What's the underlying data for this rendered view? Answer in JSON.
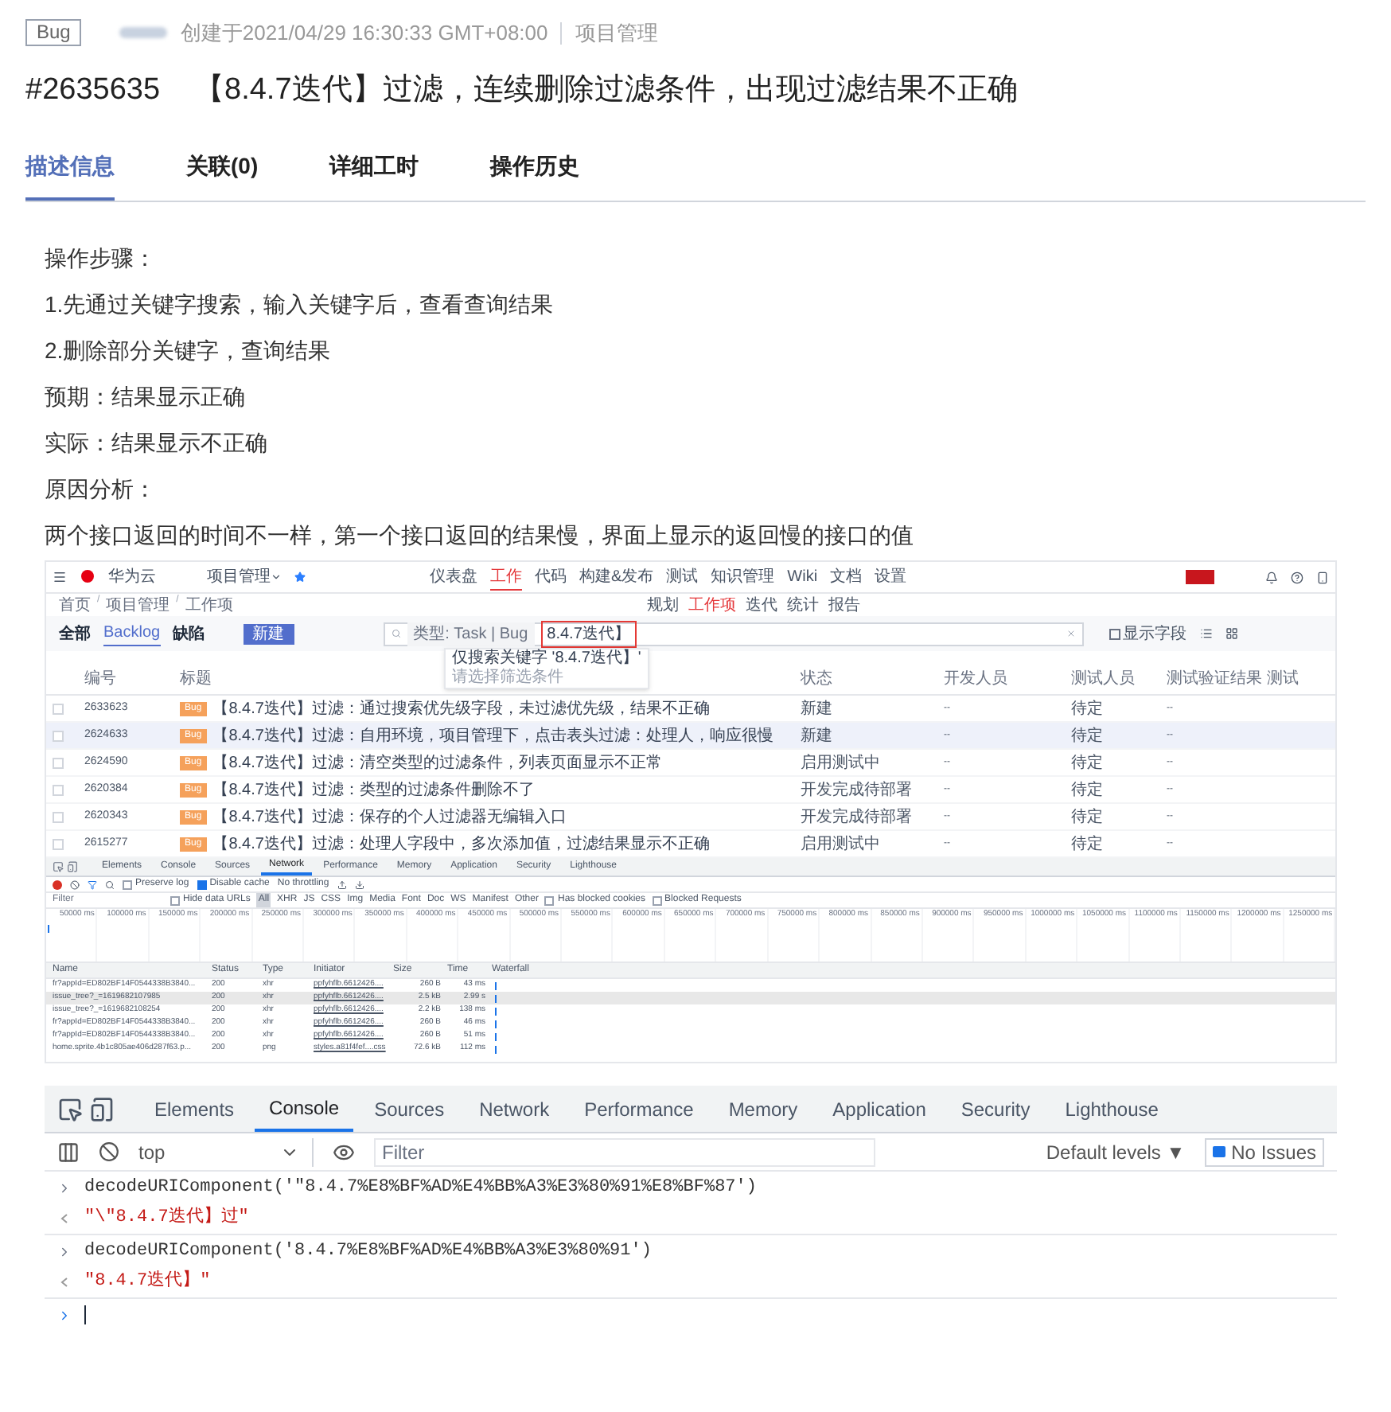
{
  "header": {
    "badge": "Bug",
    "created": "创建于2021/04/29 16:30:33 GMT+08:00",
    "project": "项目管理",
    "id": "#2635635",
    "title": "【8.4.7迭代】过滤，连续删除过滤条件，出现过滤结果不正确"
  },
  "tabs": [
    {
      "label": "描述信息",
      "selected": true
    },
    {
      "label": "关联(0)",
      "selected": false
    },
    {
      "label": "详细工时",
      "selected": false
    },
    {
      "label": "操作历史",
      "selected": false
    }
  ],
  "description": [
    "操作步骤：",
    "1.先通过关键字搜索，输入关键字后，查看查询结果",
    "2.删除部分关键字，查询结果",
    "预期：结果显示正确",
    "实际：结果显示不正确",
    "原因分析：",
    "两个接口返回的时间不一样，第一个接口返回的结果慢，界面上显示的返回慢的接口的值"
  ],
  "embedded_app": {
    "brand": "华为云",
    "project_menu": "项目管理",
    "nav": [
      {
        "label": "仪表盘",
        "selected": false
      },
      {
        "label": "工作",
        "selected": true
      },
      {
        "label": "代码",
        "selected": false
      },
      {
        "label": "构建&发布",
        "selected": false
      },
      {
        "label": "测试",
        "selected": false
      },
      {
        "label": "知识管理",
        "selected": false
      },
      {
        "label": "Wiki",
        "selected": false
      },
      {
        "label": "文档",
        "selected": false
      },
      {
        "label": "设置",
        "selected": false
      }
    ],
    "breadcrumb": [
      "首页",
      "项目管理",
      "工作项"
    ],
    "breadcrumb_separator": "/",
    "subnav": [
      {
        "label": "规划",
        "selected": false
      },
      {
        "label": "工作项",
        "selected": true
      },
      {
        "label": "迭代",
        "selected": false
      },
      {
        "label": "统计",
        "selected": false
      },
      {
        "label": "报告",
        "selected": false
      }
    ],
    "views": [
      {
        "label": "全部",
        "selected": false
      },
      {
        "label": "Backlog",
        "selected": true
      },
      {
        "label": "缺陷",
        "selected": false
      }
    ],
    "new_button": "新建",
    "filter_chip": "类型: Task | Bug",
    "search_value": "8.4.7迭代】",
    "suggestion": "仅搜索关键字 '8.4.7迭代】'",
    "suggestion_hint": "请选择筛选条件",
    "show_fields": "显示字段",
    "columns": [
      "编号",
      "标题",
      "状态",
      "开发人员",
      "测试人员",
      "测试验证结果 测试"
    ],
    "rows": [
      {
        "id": "2633623",
        "type": "Bug",
        "title": "【8.4.7迭代】过滤：通过搜索优先级字段，未过滤优先级，结果不正确",
        "status": "新建",
        "dev": "--",
        "tester": "待定",
        "result": "--",
        "selected": false
      },
      {
        "id": "2624633",
        "type": "Bug",
        "title": "【8.4.7迭代】过滤：自用环境，项目管理下，点击表头过滤：处理人，响应很慢",
        "status": "新建",
        "dev": "--",
        "tester": "待定",
        "result": "--",
        "selected": true
      },
      {
        "id": "2624590",
        "type": "Bug",
        "title": "【8.4.7迭代】过滤：清空类型的过滤条件，列表页面显示不正常",
        "status": "启用测试中",
        "dev": "--",
        "tester": "待定",
        "result": "--",
        "selected": false
      },
      {
        "id": "2620384",
        "type": "Bug",
        "title": "【8.4.7迭代】过滤：类型的过滤条件删除不了",
        "status": "开发完成待部署",
        "dev": "--",
        "tester": "待定",
        "result": "--",
        "selected": false
      },
      {
        "id": "2620343",
        "type": "Bug",
        "title": "【8.4.7迭代】过滤：保存的个人过滤器无编辑入口",
        "status": "开发完成待部署",
        "dev": "--",
        "tester": "待定",
        "result": "--",
        "selected": false
      },
      {
        "id": "2615277",
        "type": "Bug",
        "title": "【8.4.7迭代】过滤：处理人字段中，多次添加值，过滤结果显示不正确",
        "status": "启用测试中",
        "dev": "--",
        "tester": "待定",
        "result": "--",
        "selected": false
      }
    ]
  },
  "network_devtools": {
    "tabs": [
      {
        "label": "Elements",
        "selected": false
      },
      {
        "label": "Console",
        "selected": false
      },
      {
        "label": "Sources",
        "selected": false
      },
      {
        "label": "Network",
        "selected": true
      },
      {
        "label": "Performance",
        "selected": false
      },
      {
        "label": "Memory",
        "selected": false
      },
      {
        "label": "Application",
        "selected": false
      },
      {
        "label": "Security",
        "selected": false
      },
      {
        "label": "Lighthouse",
        "selected": false
      }
    ],
    "preserve_log": {
      "label": "Preserve log",
      "checked": false
    },
    "disable_cache": {
      "label": "Disable cache",
      "checked": true
    },
    "throttling": "No throttling",
    "filter_placeholder": "Filter",
    "hide_data_urls": {
      "label": "Hide data URLs",
      "checked": false
    },
    "types": [
      {
        "label": "All",
        "selected": true
      },
      {
        "label": "XHR",
        "selected": false
      },
      {
        "label": "JS",
        "selected": false
      },
      {
        "label": "CSS",
        "selected": false
      },
      {
        "label": "Img",
        "selected": false
      },
      {
        "label": "Media",
        "selected": false
      },
      {
        "label": "Font",
        "selected": false
      },
      {
        "label": "Doc",
        "selected": false
      },
      {
        "label": "WS",
        "selected": false
      },
      {
        "label": "Manifest",
        "selected": false
      },
      {
        "label": "Other",
        "selected": false
      }
    ],
    "blocked_cookies": {
      "label": "Has blocked cookies",
      "checked": false
    },
    "blocked_requests": {
      "label": "Blocked Requests",
      "checked": false
    },
    "ticks": [
      "50000 ms",
      "100000 ms",
      "150000 ms",
      "200000 ms",
      "250000 ms",
      "300000 ms",
      "350000 ms",
      "400000 ms",
      "450000 ms",
      "500000 ms",
      "550000 ms",
      "600000 ms",
      "650000 ms",
      "700000 ms",
      "750000 ms",
      "800000 ms",
      "850000 ms",
      "900000 ms",
      "950000 ms",
      "1000000 ms",
      "1050000 ms",
      "1100000 ms",
      "1150000 ms",
      "1200000 ms",
      "1250000 ms"
    ],
    "columns": [
      "Name",
      "Status",
      "Type",
      "Initiator",
      "Size",
      "Time",
      "Waterfall"
    ],
    "requests": [
      {
        "name": "fr?appId=ED802BF14F0544338B3840...",
        "status": "200",
        "type": "xhr",
        "initiator": "ppfyhflb.6612426....",
        "size": "260 B",
        "time": "43 ms",
        "selected": false
      },
      {
        "name": "issue_tree?_=1619682107985",
        "status": "200",
        "type": "xhr",
        "initiator": "ppfyhflb.6612426....",
        "size": "2.5 kB",
        "time": "2.99 s",
        "selected": true
      },
      {
        "name": "issue_tree?_=1619682108254",
        "status": "200",
        "type": "xhr",
        "initiator": "ppfyhflb.6612426....",
        "size": "2.2 kB",
        "time": "138 ms",
        "selected": false
      },
      {
        "name": "fr?appId=ED802BF14F0544338B3840...",
        "status": "200",
        "type": "xhr",
        "initiator": "ppfyhflb.6612426....",
        "size": "260 B",
        "time": "46 ms",
        "selected": false
      },
      {
        "name": "fr?appId=ED802BF14F0544338B3840...",
        "status": "200",
        "type": "xhr",
        "initiator": "ppfyhflb.6612426....",
        "size": "260 B",
        "time": "51 ms",
        "selected": false
      },
      {
        "name": "home.sprite.4b1c805ae406d287f63.p...",
        "status": "200",
        "type": "png",
        "initiator": "styles.a81f4fef....css",
        "size": "72.6 kB",
        "time": "112 ms",
        "selected": false
      }
    ]
  },
  "console": {
    "tabs": [
      {
        "label": "Elements",
        "selected": false
      },
      {
        "label": "Console",
        "selected": true
      },
      {
        "label": "Sources",
        "selected": false
      },
      {
        "label": "Network",
        "selected": false
      },
      {
        "label": "Performance",
        "selected": false
      },
      {
        "label": "Memory",
        "selected": false
      },
      {
        "label": "Application",
        "selected": false
      },
      {
        "label": "Security",
        "selected": false
      },
      {
        "label": "Lighthouse",
        "selected": false
      }
    ],
    "context": "top",
    "filter_placeholder": "Filter",
    "levels": "Default levels ▼",
    "issues": "No Issues",
    "lines": [
      {
        "kind": "input",
        "text": "decodeURIComponent('\"8.4.7%E8%BF%AD%E4%BB%A3%E3%80%91%E8%BF%87')"
      },
      {
        "kind": "output",
        "text": "\"\\\"8.4.7迭代】过\""
      },
      {
        "kind": "input",
        "text": "decodeURIComponent('8.4.7%E8%BF%AD%E4%BB%A3%E3%80%91')"
      },
      {
        "kind": "output",
        "text": "\"8.4.7迭代】\""
      },
      {
        "kind": "prompt"
      }
    ]
  }
}
